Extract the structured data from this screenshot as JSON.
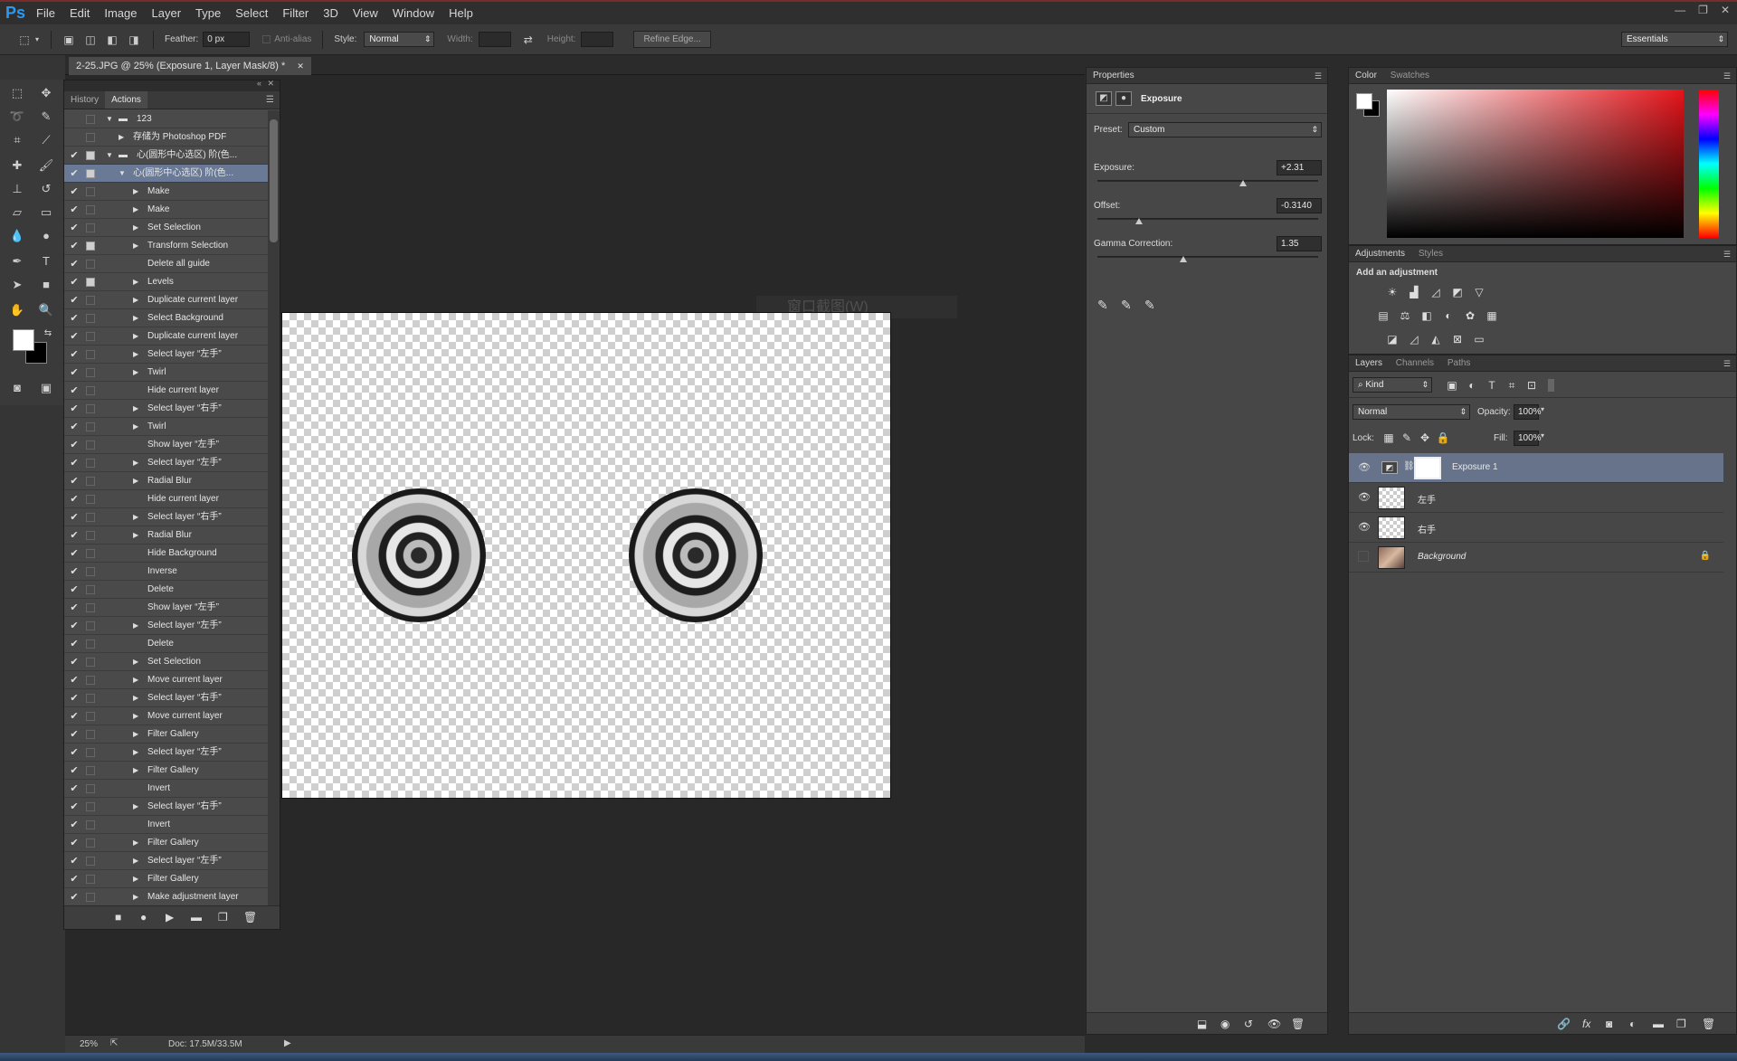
{
  "app": {
    "logo": "Ps"
  },
  "menu": [
    "File",
    "Edit",
    "Image",
    "Layer",
    "Type",
    "Select",
    "Filter",
    "3D",
    "View",
    "Window",
    "Help"
  ],
  "window_controls": {
    "minimize": "—",
    "restore": "❐",
    "close": "✕"
  },
  "options": {
    "feather_label": "Feather:",
    "feather_value": "0 px",
    "antialias_label": "Anti-alias",
    "style_label": "Style:",
    "style_value": "Normal",
    "width_label": "Width:",
    "height_label": "Height:",
    "refine_label": "Refine Edge...",
    "workspace": "Essentials"
  },
  "document": {
    "tab_title": "2-25.JPG @ 25% (Exposure 1, Layer Mask/8) *",
    "watermark": "窗口截图(W)"
  },
  "status": {
    "zoom": "25%",
    "doc": "Doc: 17.5M/33.5M"
  },
  "actions_panel": {
    "tabs": [
      "History",
      "Actions"
    ],
    "rows": [
      {
        "label": "123",
        "check": "",
        "dlg": false,
        "tri": "▼",
        "indent": 0,
        "folder": true,
        "sel": false
      },
      {
        "label": "存储为 Photoshop PDF",
        "check": "",
        "dlg": false,
        "tri": "▶",
        "indent": 1,
        "folder": false,
        "sel": false
      },
      {
        "label": "心(圆形中心选区) 阶(色...",
        "check": "✔",
        "dlg": true,
        "tri": "▼",
        "indent": 0,
        "folder": true,
        "sel": false
      },
      {
        "label": "心(圆形中心选区) 阶(色...",
        "check": "✔",
        "dlg": true,
        "tri": "▼",
        "indent": 1,
        "folder": false,
        "sel": true
      },
      {
        "label": "Make",
        "check": "✔",
        "dlg": false,
        "tri": "▶",
        "indent": 2,
        "folder": false,
        "sel": false
      },
      {
        "label": "Make",
        "check": "✔",
        "dlg": false,
        "tri": "▶",
        "indent": 2,
        "folder": false,
        "sel": false
      },
      {
        "label": "Set Selection",
        "check": "✔",
        "dlg": false,
        "tri": "▶",
        "indent": 2,
        "folder": false,
        "sel": false
      },
      {
        "label": "Transform Selection",
        "check": "✔",
        "dlg": true,
        "tri": "▶",
        "indent": 2,
        "folder": false,
        "sel": false
      },
      {
        "label": "Delete all guide",
        "check": "✔",
        "dlg": false,
        "tri": "",
        "indent": 2,
        "folder": false,
        "sel": false
      },
      {
        "label": "Levels",
        "check": "✔",
        "dlg": true,
        "tri": "▶",
        "indent": 2,
        "folder": false,
        "sel": false
      },
      {
        "label": "Duplicate current layer",
        "check": "✔",
        "dlg": false,
        "tri": "▶",
        "indent": 2,
        "folder": false,
        "sel": false
      },
      {
        "label": "Select Background",
        "check": "✔",
        "dlg": false,
        "tri": "▶",
        "indent": 2,
        "folder": false,
        "sel": false
      },
      {
        "label": "Duplicate current layer",
        "check": "✔",
        "dlg": false,
        "tri": "▶",
        "indent": 2,
        "folder": false,
        "sel": false
      },
      {
        "label": "Select layer “左手”",
        "check": "✔",
        "dlg": false,
        "tri": "▶",
        "indent": 2,
        "folder": false,
        "sel": false
      },
      {
        "label": "Twirl",
        "check": "✔",
        "dlg": false,
        "tri": "▶",
        "indent": 2,
        "folder": false,
        "sel": false
      },
      {
        "label": "Hide current layer",
        "check": "✔",
        "dlg": false,
        "tri": "",
        "indent": 2,
        "folder": false,
        "sel": false
      },
      {
        "label": "Select layer “右手”",
        "check": "✔",
        "dlg": false,
        "tri": "▶",
        "indent": 2,
        "folder": false,
        "sel": false
      },
      {
        "label": "Twirl",
        "check": "✔",
        "dlg": false,
        "tri": "▶",
        "indent": 2,
        "folder": false,
        "sel": false
      },
      {
        "label": "Show layer “左手”",
        "check": "✔",
        "dlg": false,
        "tri": "",
        "indent": 2,
        "folder": false,
        "sel": false
      },
      {
        "label": "Select layer “左手”",
        "check": "✔",
        "dlg": false,
        "tri": "▶",
        "indent": 2,
        "folder": false,
        "sel": false
      },
      {
        "label": "Radial Blur",
        "check": "✔",
        "dlg": false,
        "tri": "▶",
        "indent": 2,
        "folder": false,
        "sel": false
      },
      {
        "label": "Hide current layer",
        "check": "✔",
        "dlg": false,
        "tri": "",
        "indent": 2,
        "folder": false,
        "sel": false
      },
      {
        "label": "Select layer “右手”",
        "check": "✔",
        "dlg": false,
        "tri": "▶",
        "indent": 2,
        "folder": false,
        "sel": false
      },
      {
        "label": "Radial Blur",
        "check": "✔",
        "dlg": false,
        "tri": "▶",
        "indent": 2,
        "folder": false,
        "sel": false
      },
      {
        "label": "Hide Background",
        "check": "✔",
        "dlg": false,
        "tri": "",
        "indent": 2,
        "folder": false,
        "sel": false
      },
      {
        "label": "Inverse",
        "check": "✔",
        "dlg": false,
        "tri": "",
        "indent": 2,
        "folder": false,
        "sel": false
      },
      {
        "label": "Delete",
        "check": "✔",
        "dlg": false,
        "tri": "",
        "indent": 2,
        "folder": false,
        "sel": false
      },
      {
        "label": "Show layer “左手”",
        "check": "✔",
        "dlg": false,
        "tri": "",
        "indent": 2,
        "folder": false,
        "sel": false
      },
      {
        "label": "Select layer “左手”",
        "check": "✔",
        "dlg": false,
        "tri": "▶",
        "indent": 2,
        "folder": false,
        "sel": false
      },
      {
        "label": "Delete",
        "check": "✔",
        "dlg": false,
        "tri": "",
        "indent": 2,
        "folder": false,
        "sel": false
      },
      {
        "label": "Set Selection",
        "check": "✔",
        "dlg": false,
        "tri": "▶",
        "indent": 2,
        "folder": false,
        "sel": false
      },
      {
        "label": "Move current layer",
        "check": "✔",
        "dlg": false,
        "tri": "▶",
        "indent": 2,
        "folder": false,
        "sel": false
      },
      {
        "label": "Select layer “右手”",
        "check": "✔",
        "dlg": false,
        "tri": "▶",
        "indent": 2,
        "folder": false,
        "sel": false
      },
      {
        "label": "Move current layer",
        "check": "✔",
        "dlg": false,
        "tri": "▶",
        "indent": 2,
        "folder": false,
        "sel": false
      },
      {
        "label": "Filter Gallery",
        "check": "✔",
        "dlg": false,
        "tri": "▶",
        "indent": 2,
        "folder": false,
        "sel": false
      },
      {
        "label": "Select layer “左手”",
        "check": "✔",
        "dlg": false,
        "tri": "▶",
        "indent": 2,
        "folder": false,
        "sel": false
      },
      {
        "label": "Filter Gallery",
        "check": "✔",
        "dlg": false,
        "tri": "▶",
        "indent": 2,
        "folder": false,
        "sel": false
      },
      {
        "label": "Invert",
        "check": "✔",
        "dlg": false,
        "tri": "",
        "indent": 2,
        "folder": false,
        "sel": false
      },
      {
        "label": "Select layer “右手”",
        "check": "✔",
        "dlg": false,
        "tri": "▶",
        "indent": 2,
        "folder": false,
        "sel": false
      },
      {
        "label": "Invert",
        "check": "✔",
        "dlg": false,
        "tri": "",
        "indent": 2,
        "folder": false,
        "sel": false
      },
      {
        "label": "Filter Gallery",
        "check": "✔",
        "dlg": false,
        "tri": "▶",
        "indent": 2,
        "folder": false,
        "sel": false
      },
      {
        "label": "Select layer “左手”",
        "check": "✔",
        "dlg": false,
        "tri": "▶",
        "indent": 2,
        "folder": false,
        "sel": false
      },
      {
        "label": "Filter Gallery",
        "check": "✔",
        "dlg": false,
        "tri": "▶",
        "indent": 2,
        "folder": false,
        "sel": false
      },
      {
        "label": "Make adjustment layer",
        "check": "✔",
        "dlg": false,
        "tri": "▶",
        "indent": 2,
        "folder": false,
        "sel": false
      }
    ]
  },
  "properties": {
    "tab": "Properties",
    "title": "Exposure",
    "preset_label": "Preset:",
    "preset_value": "Custom",
    "exposure_label": "Exposure:",
    "exposure_value": "+2.31",
    "exposure_level": 0.66,
    "offset_label": "Offset:",
    "offset_value": "-0.3140",
    "offset_level": 0.19,
    "gamma_label": "Gamma Correction:",
    "gamma_value": "1.35",
    "gamma_level": 0.39
  },
  "color_panel": {
    "tabs": [
      "Color",
      "Swatches"
    ]
  },
  "adjustments": {
    "tabs": [
      "Adjustments",
      "Styles"
    ],
    "heading": "Add an adjustment"
  },
  "layers_panel": {
    "tabs": [
      "Layers",
      "Channels",
      "Paths"
    ],
    "kind_label": "Kind",
    "blend_mode": "Normal",
    "opacity_label": "Opacity:",
    "opacity_value": "100%",
    "lock_label": "Lock:",
    "fill_label": "Fill:",
    "fill_value": "100%",
    "layers": [
      {
        "name": "Exposure 1",
        "visible": true,
        "sel": true,
        "type": "adjustment",
        "locked": false
      },
      {
        "name": "左手",
        "visible": true,
        "sel": false,
        "type": "pixel",
        "locked": false
      },
      {
        "name": "右手",
        "visible": true,
        "sel": false,
        "type": "pixel",
        "locked": false
      },
      {
        "name": "Background",
        "visible": false,
        "sel": false,
        "type": "background",
        "locked": true
      }
    ]
  }
}
